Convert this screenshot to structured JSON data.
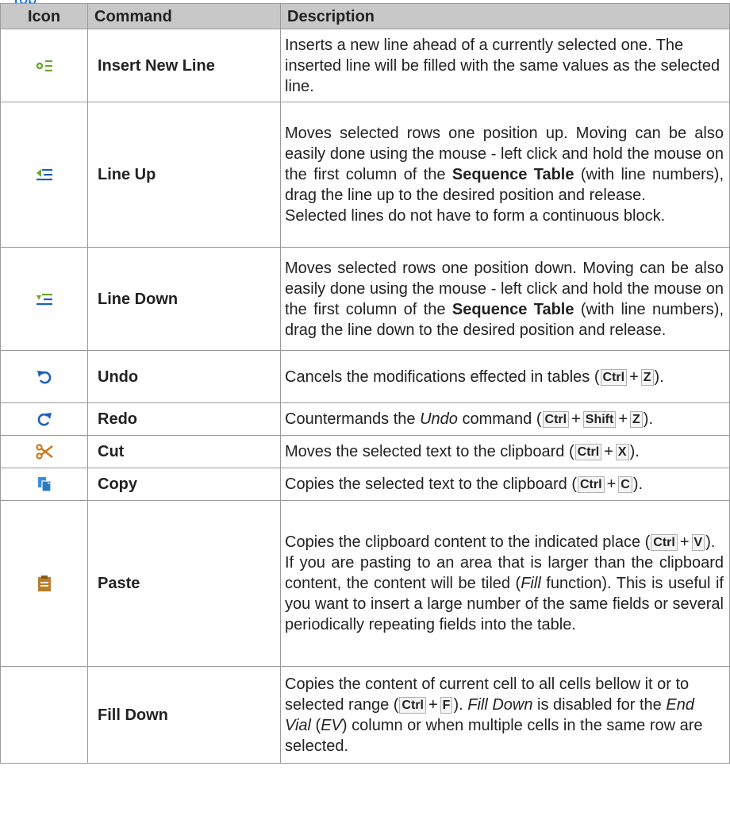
{
  "nav": {
    "link": "Top"
  },
  "table": {
    "headers": {
      "icon": "Icon",
      "command": "Command",
      "description": "Description"
    },
    "rows": [
      {
        "icon": "insert-line-icon",
        "command": "Insert New Line",
        "desc": {
          "text": "Inserts a new line ahead of a currently selected one. The inserted line will be filled with the same values as the selected line."
        }
      },
      {
        "icon": "line-up-icon",
        "command": "Line Up",
        "desc": {
          "p1": "Moves selected rows one position up. Moving can be also easily done using the mouse - left click and hold the mouse on the first column of the ",
          "strong1": "Sequence Table",
          "p2": " (with line numbers), drag the line up to the desired position and release.",
          "p3": "Selected lines do not have to form a continuous block."
        }
      },
      {
        "icon": "line-down-icon",
        "command": "Line Down",
        "desc": {
          "p1": "Moves selected rows one position down. Moving can be also easily done using the mouse - left click and hold the mouse on the first column of the ",
          "strong1": "Sequence Table",
          "p2": " (with line numbers), drag the line down to the desired position and release."
        }
      },
      {
        "icon": "undo-icon",
        "command": "Undo",
        "desc": {
          "text": "Cancels the modifications effected in tables (",
          "k1": "Ctrl",
          "k2": "Z",
          "end": ")."
        }
      },
      {
        "icon": "redo-icon",
        "command": "Redo",
        "desc": {
          "t1": "Countermands the ",
          "em1": "Undo",
          "t2": " command (",
          "k1": "Ctrl",
          "k2": "Shift",
          "k3": "Z",
          "end": ")."
        }
      },
      {
        "icon": "cut-icon",
        "command": "Cut",
        "desc": {
          "text": "Moves the selected text to the clipboard (",
          "k1": "Ctrl",
          "k2": "X",
          "end": ")."
        }
      },
      {
        "icon": "copy-icon",
        "command": "Copy",
        "desc": {
          "text": "Copies the selected text to the clipboard (",
          "k1": "Ctrl",
          "k2": "C",
          "end": ")."
        }
      },
      {
        "icon": "paste-icon",
        "command": "Paste",
        "desc": {
          "t1": "Copies the clipboard content to the indicated place (",
          "k1": "Ctrl",
          "k2": "V",
          "t2": ").",
          "p2a": "If you are pasting to an area that is larger than the clipboard content, the content will be tiled (",
          "em1": "Fill",
          "p2b": " function). This is useful if you want to insert a large number of the same fields or several periodically repeating fields into the table."
        }
      },
      {
        "icon": "fill-down-icon",
        "command": "Fill Down",
        "desc": {
          "t1": "Copies the content of current cell to all cells bellow it or to selected range (",
          "k1": "Ctrl",
          "k2": "F",
          "t2": "). ",
          "em1": "Fill Down",
          "t3": " is disabled for the ",
          "em2": "End Vial",
          "t4": " (",
          "em3": "EV",
          "t5": ") column or when multiple cells in the same row are selected."
        }
      }
    ]
  },
  "colors": {
    "header_bg": "#c8c8c8",
    "green": "#6aa82c",
    "blue": "#1f5fb8",
    "orange": "#c67a1a",
    "copy_blue": "#3a8fd6",
    "paste_brown": "#b87d2c"
  }
}
